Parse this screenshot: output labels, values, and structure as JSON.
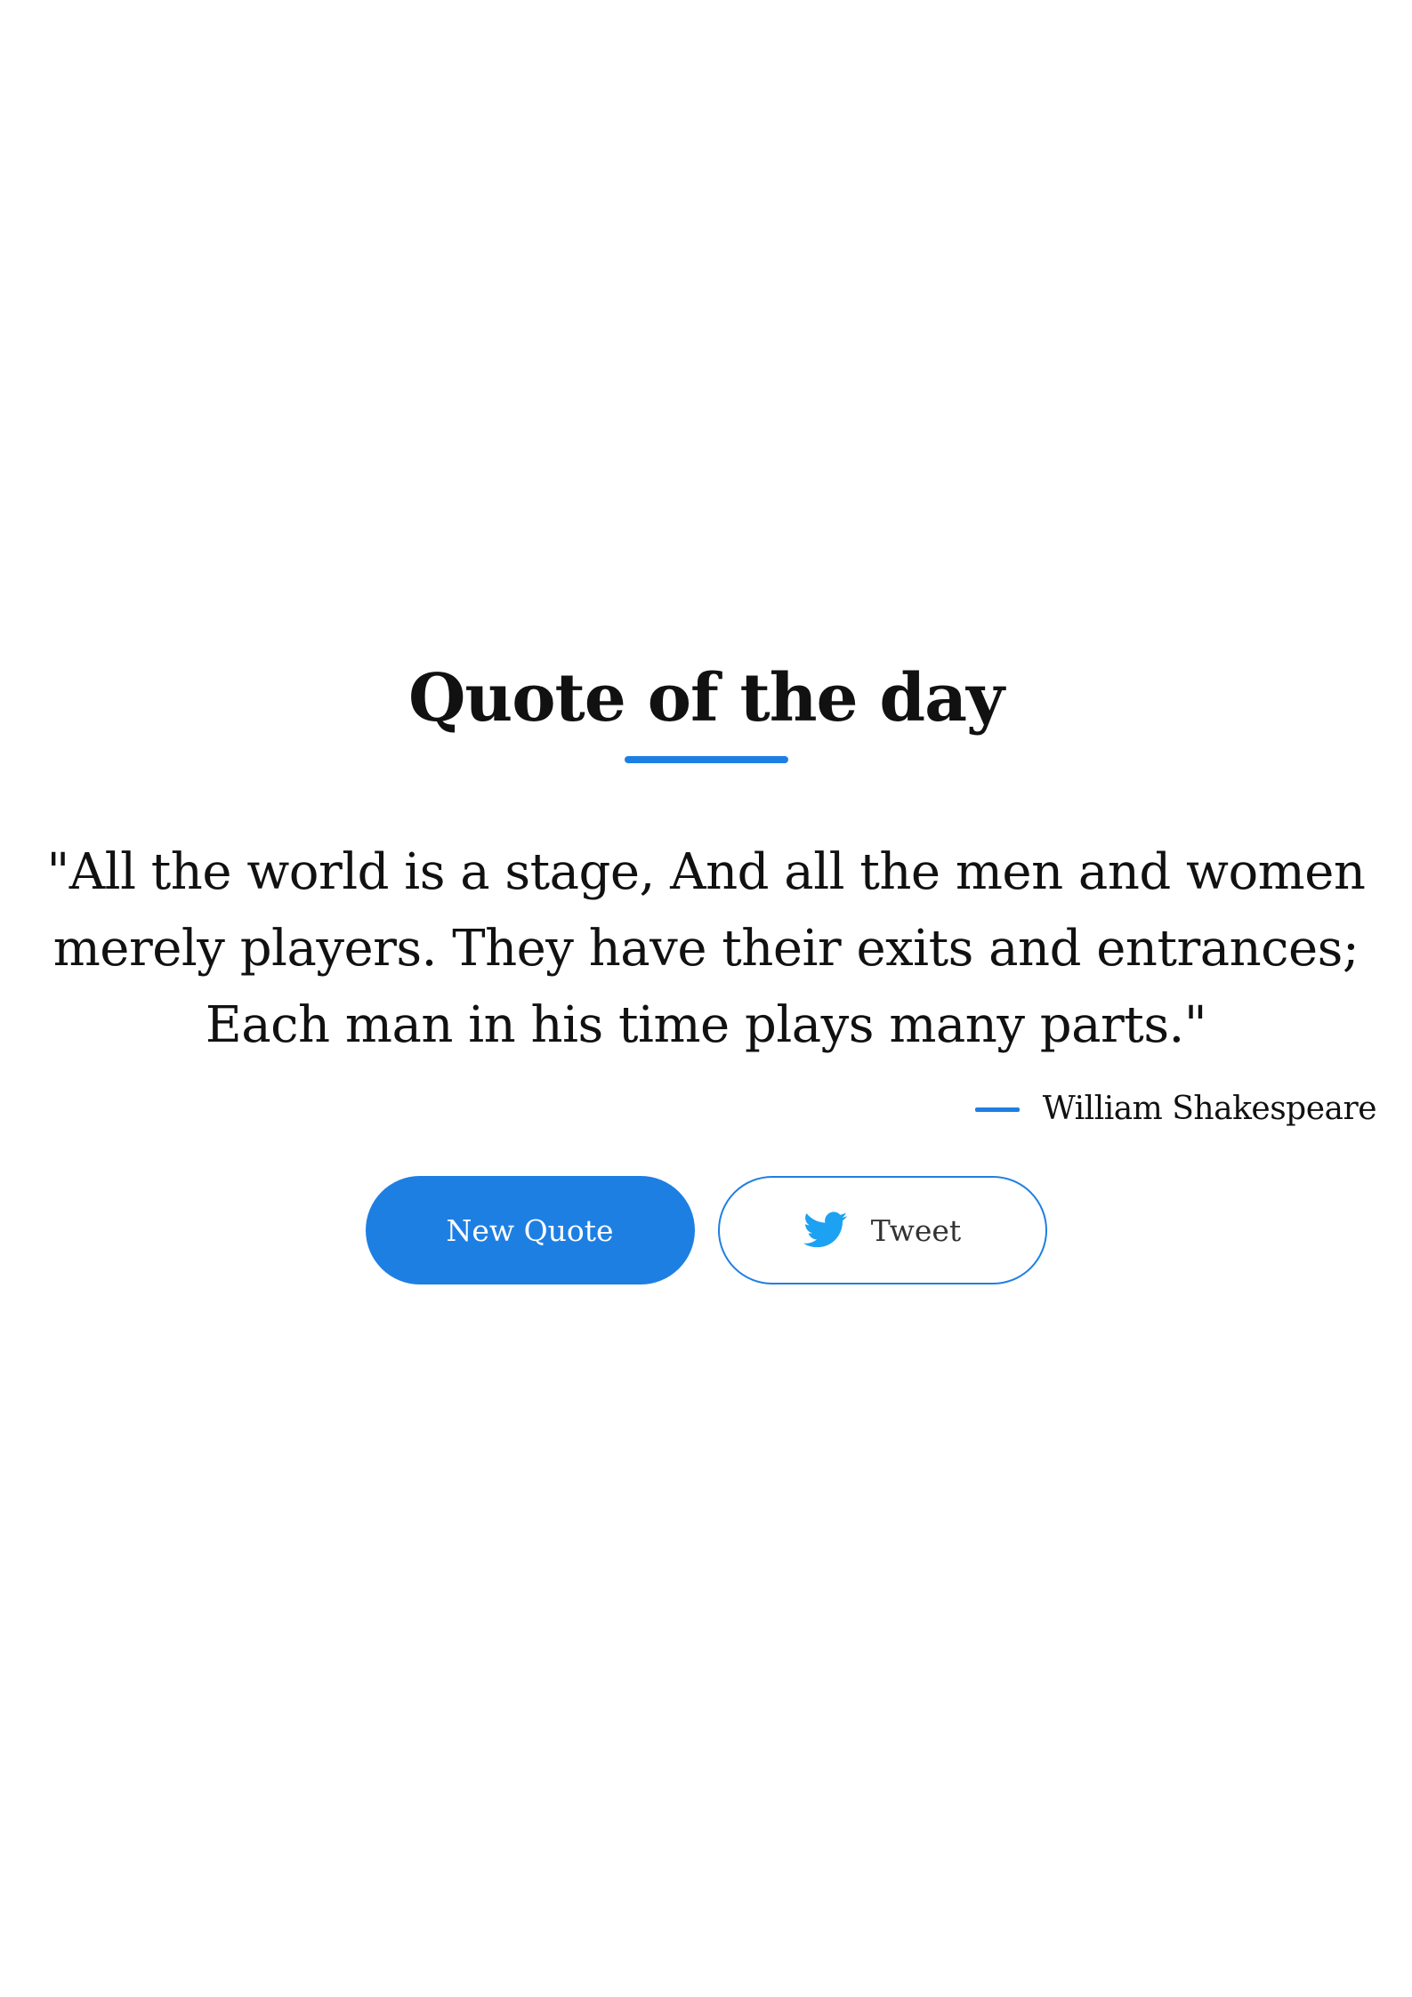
{
  "header": {
    "title": "Quote of the day"
  },
  "quote": {
    "text": "\"All the world is a stage, And all the men and women merely players. They have their exits and entrances; Each man in his time plays many parts.\"",
    "author": "William Shakespeare"
  },
  "actions": {
    "new_quote_label": "New Quote",
    "tweet_label": "Tweet",
    "tweet_icon": "twitter-bird-icon"
  },
  "colors": {
    "accent": "#1e7fe3",
    "twitter": "#1da1f2",
    "text": "#111111"
  }
}
